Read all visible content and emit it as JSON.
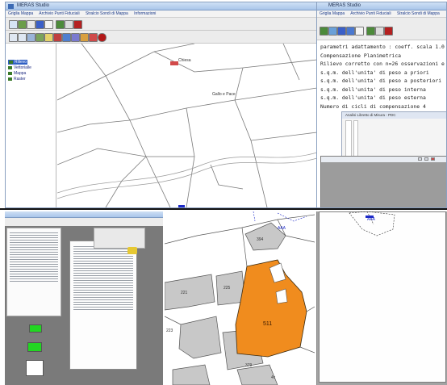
{
  "app": {
    "title": "MERAS Studio",
    "menu": [
      "Griglia Mappa",
      "Archivio Punti Fiduciali",
      "Stralcio Sondi di Mappa",
      "Informazioni"
    ]
  },
  "tree": {
    "items": [
      "Rilievo",
      "Vettorialle",
      "Mappa",
      "Raster"
    ]
  },
  "console": {
    "lines": [
      "parametri adattamento : coeff. scala 1.0",
      " Compensazione Planimetrica",
      "Rilievo corretto con n=26 osservazioni e",
      "s.q.m. dell'unita' di peso a priori",
      "s.q.m. dell'unita' di peso a posteriori",
      "s.q.m. dell'unita' di peso interna",
      "s.q.m. dell'unita' di peso esterna",
      "Numero di cicli di compensazione 4"
    ]
  },
  "subwindow": {
    "title": "Analisi Libretto di Misura - PDC"
  },
  "map": {
    "top_labels": [
      "Chiesa",
      "Gallo e Pace"
    ],
    "parcel_labels": [
      "221",
      "225",
      "223",
      "511",
      "379",
      "394",
      "AAA",
      "AAA",
      "AAA",
      "4x"
    ]
  },
  "colors": {
    "parcel_highlight": "#f08c1e",
    "building_fill": "#c8c8c8",
    "accent_blue": "#1d2ac8"
  },
  "icons": [
    "new-file-icon",
    "save-icon",
    "print-icon",
    "zoom-in-icon",
    "zoom-out-icon",
    "pan-icon",
    "select-icon",
    "measure-icon",
    "stop-icon"
  ]
}
